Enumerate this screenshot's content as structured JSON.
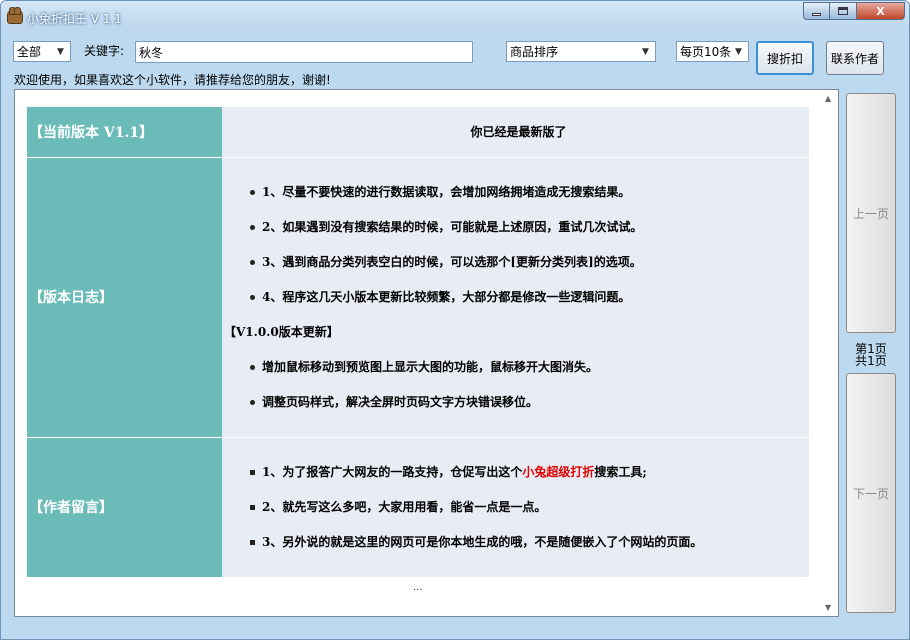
{
  "window": {
    "title": "小兔折扣王 V 1.1",
    "app_icon": "bear-icon"
  },
  "window_buttons": {
    "minimize": "minimize-icon",
    "maximize": "maximize-icon",
    "close": "X"
  },
  "toolbar": {
    "category": {
      "selected": "全部"
    },
    "keyword_label": "关键字:",
    "keyword_value": "秋冬",
    "sort": {
      "selected": "商品排序"
    },
    "per_page": {
      "selected": "每页10条"
    },
    "search_button": "搜折扣",
    "contact_button": "联系作者",
    "welcome": "欢迎使用，如果喜欢这个小软件，请推荐给您的朋友，谢谢!"
  },
  "content": {
    "version": {
      "head": "【当前版本  V1.1】",
      "text": "你已经是最新版了"
    },
    "log": {
      "head": "【版本日志】",
      "items": [
        "1、尽量不要快速的进行数据读取，会增加网络拥堵造成无搜索结果。",
        "2、如果遇到没有搜索结果的时候，可能就是上述原因，重试几次试试。",
        "3、遇到商品分类列表空白的时候，可以选那个[更新分类列表]的选项。",
        "4、程序这几天小版本更新比较频繁，大部分都是修改一些逻辑问题。"
      ],
      "sub_heading": "【V1.0.0版本更新】",
      "sub_items": [
        "增加鼠标移动到预览图上显示大图的功能，鼠标移开大图消失。",
        "调整页码样式，解决全屏时页码文字方块错误移位。"
      ]
    },
    "note": {
      "head": "【作者留言】",
      "item1_pre": "1、为了报答广大网友的一路支持，仓促写出这个",
      "item1_highlight": "小兔超级打折",
      "item1_post": "搜索工具;",
      "item2": "2、就先写这么多吧，大家用用看，能省一点是一点。",
      "item3": "3、另外说的就是这里的网页可是你本地生成的哦，不是随便嵌入了个网站的页面。"
    },
    "ellipsis": "...",
    "highlight_color": "#e00000",
    "header_color": "#6bbcb9"
  },
  "pager": {
    "prev": "上一页",
    "next": "下一页",
    "current": "第1页",
    "total": "共1页"
  }
}
